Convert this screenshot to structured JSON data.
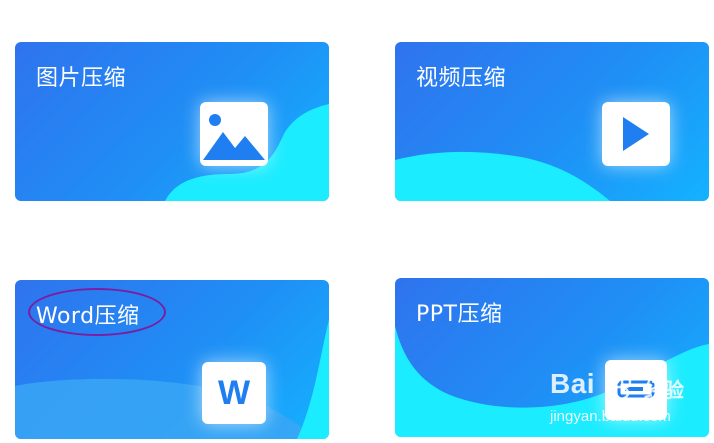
{
  "cards": [
    {
      "title": "图片压缩",
      "icon": "image-icon"
    },
    {
      "title": "视频压缩",
      "icon": "play-icon"
    },
    {
      "title": "Word压缩",
      "icon": "word-icon",
      "icon_letter": "W"
    },
    {
      "title": "PPT压缩",
      "icon": "ppt-icon"
    }
  ],
  "colors": {
    "card_gradient_start": "#2f73ee",
    "card_gradient_end": "#14b2ff",
    "wave_light": "#1cecff",
    "icon_blue": "#1f7ff0",
    "highlight_ring": "#7a1fa0"
  },
  "watermark": {
    "brand": "Bai",
    "brand_cn": "经验",
    "url": "jingyan.baidu.com"
  }
}
